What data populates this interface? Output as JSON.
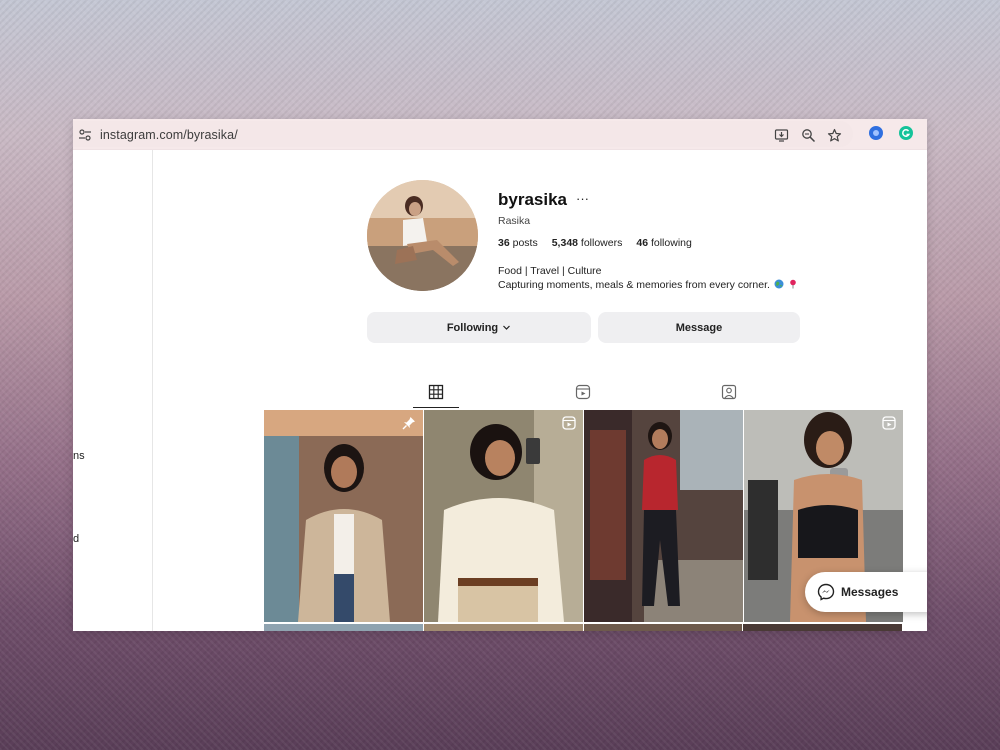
{
  "browser": {
    "url": "instagram.com/byrasika/",
    "icons": [
      "site-settings-icon",
      "install-app-icon",
      "zoom-icon",
      "bookmark-star-icon",
      "extension-icon",
      "grammarly-icon"
    ]
  },
  "sidebar": {
    "fragment_1": "ns",
    "fragment_2": "d"
  },
  "profile": {
    "username": "byrasika",
    "more": "···",
    "full_name": "Rasika",
    "stats": {
      "posts_count": "36",
      "posts_label": "posts",
      "followers_count": "5,348",
      "followers_label": "followers",
      "following_count": "46",
      "following_label": "following"
    },
    "bio_line_1": "Food | Travel | Culture",
    "bio_line_2": "Capturing moments, meals & memories from every corner."
  },
  "actions": {
    "following_label": "Following",
    "message_label": "Message"
  },
  "tabs": [
    "posts-grid-icon",
    "reels-icon",
    "tagged-icon"
  ],
  "posts": [
    {
      "type": "pinned",
      "icon": "pin-icon"
    },
    {
      "type": "reel",
      "icon": "reel-icon"
    },
    {
      "type": "photo",
      "icon": ""
    },
    {
      "type": "reel",
      "icon": "reel-icon"
    }
  ],
  "messages": {
    "label": "Messages"
  },
  "colors": {
    "window_bg": "#ffffff",
    "address_bar": "#f6e9ea",
    "button_bg": "#efeff1"
  }
}
